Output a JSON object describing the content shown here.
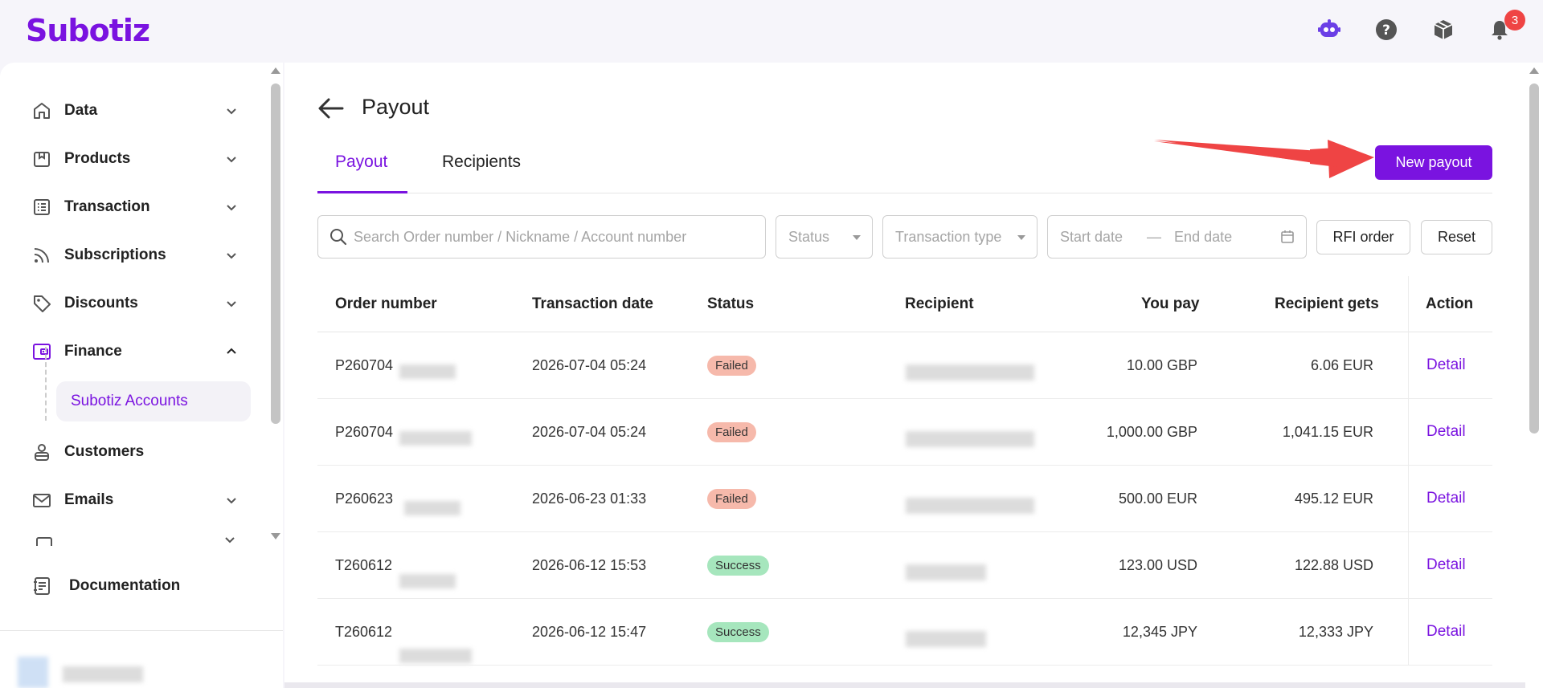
{
  "app": {
    "logo": "Subotiz",
    "notification_count": "3"
  },
  "sidebar": {
    "items": [
      {
        "label": "Data",
        "icon": "home-icon",
        "expanded": false
      },
      {
        "label": "Products",
        "icon": "box-icon",
        "expanded": false
      },
      {
        "label": "Transaction",
        "icon": "list-icon",
        "expanded": false
      },
      {
        "label": "Subscriptions",
        "icon": "rss-icon",
        "expanded": false
      },
      {
        "label": "Discounts",
        "icon": "tag-icon",
        "expanded": false
      },
      {
        "label": "Finance",
        "icon": "wallet-icon",
        "expanded": true
      },
      {
        "label": "Customers",
        "icon": "user-icon",
        "expanded": false
      },
      {
        "label": "Emails",
        "icon": "mail-icon",
        "expanded": false
      }
    ],
    "sub_item": "Subotiz Accounts",
    "documentation": "Documentation"
  },
  "page": {
    "title": "Payout",
    "tabs": [
      "Payout",
      "Recipients"
    ],
    "active_tab": "Payout",
    "new_button": "New payout"
  },
  "filters": {
    "search_placeholder": "Search Order number / Nickname / Account number",
    "status_placeholder": "Status",
    "type_placeholder": "Transaction type",
    "start_date_placeholder": "Start date",
    "date_separator": "—",
    "end_date_placeholder": "End date",
    "rfi_button": "RFI order",
    "reset_button": "Reset"
  },
  "table": {
    "columns": [
      "Order number",
      "Transaction date",
      "Status",
      "Recipient",
      "You pay",
      "Recipient gets",
      "Action"
    ],
    "rows": [
      {
        "order": "P260704",
        "date": "2026-07-04 05:24",
        "status": "Failed",
        "you_pay": "10.00 GBP",
        "recipient_gets": "6.06 EUR",
        "action": "Detail"
      },
      {
        "order": "P260704",
        "date": "2026-07-04 05:24",
        "status": "Failed",
        "you_pay": "1,000.00 GBP",
        "recipient_gets": "1,041.15 EUR",
        "action": "Detail"
      },
      {
        "order": "P260623",
        "date": "2026-06-23 01:33",
        "status": "Failed",
        "you_pay": "500.00 EUR",
        "recipient_gets": "495.12 EUR",
        "action": "Detail"
      },
      {
        "order": "T260612",
        "date": "2026-06-12 15:53",
        "status": "Success",
        "you_pay": "123.00 USD",
        "recipient_gets": "122.88 USD",
        "action": "Detail"
      },
      {
        "order": "T260612",
        "date": "2026-06-12 15:47",
        "status": "Success",
        "you_pay": "12,345 JPY",
        "recipient_gets": "12,333 JPY",
        "action": "Detail"
      }
    ]
  },
  "colors": {
    "brand": "#7a13e0",
    "failed": "#f6b9ab",
    "success": "#a6e6bd",
    "annotation_arrow": "#ef4444"
  }
}
